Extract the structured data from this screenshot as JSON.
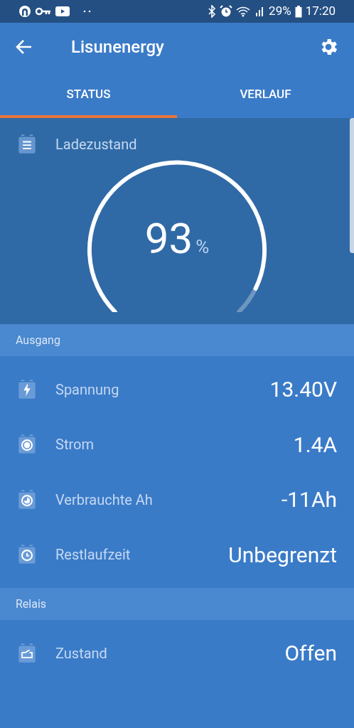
{
  "status_bar": {
    "battery": "29%",
    "time": "17:20"
  },
  "header": {
    "title": "Lisunenergy"
  },
  "tabs": [
    {
      "label": "STATUS",
      "selected": true
    },
    {
      "label": "VERLAUF",
      "selected": false
    }
  ],
  "gauge": {
    "title": "Ladezustand",
    "value": "93",
    "unit": "%"
  },
  "sections": [
    {
      "title": "Ausgang",
      "rows": [
        {
          "label": "Spannung",
          "value": "13.40V"
        },
        {
          "label": "Strom",
          "value": "1.4A"
        },
        {
          "label": "Verbrauchte Ah",
          "value": "-11Ah"
        },
        {
          "label": "Restlaufzeit",
          "value": "Unbegrenzt"
        }
      ]
    },
    {
      "title": "Relais",
      "rows": [
        {
          "label": "Zustand",
          "value": "Offen"
        }
      ]
    }
  ]
}
